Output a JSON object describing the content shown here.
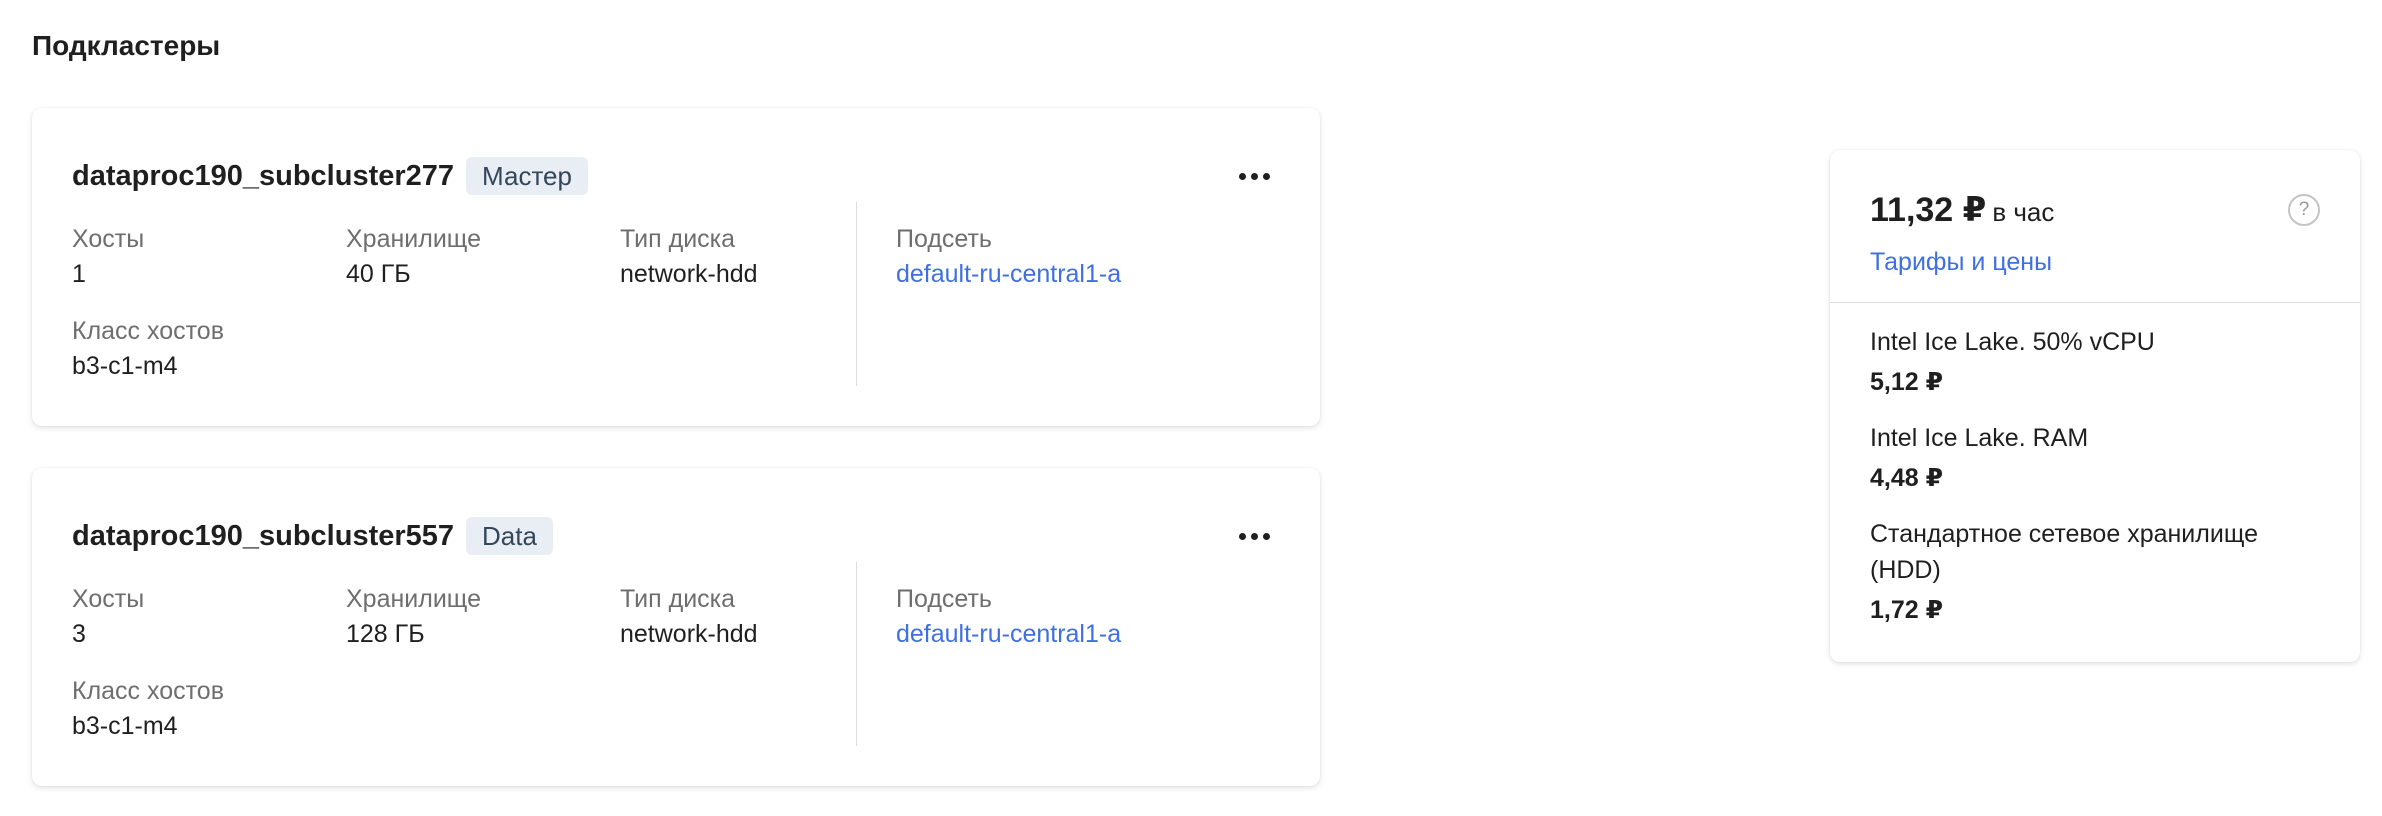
{
  "section": {
    "title": "Подкластеры"
  },
  "subclusters": [
    {
      "name": "dataproc190_subcluster277",
      "role": "Мастер",
      "hosts_label": "Хосты",
      "hosts_value": "1",
      "storage_label": "Хранилище",
      "storage_value": "40 ГБ",
      "disk_label": "Тип диска",
      "disk_value": "network-hdd",
      "subnet_label": "Подсеть",
      "subnet_value": "default-ru-central1-a",
      "class_label": "Класс хостов",
      "class_value": "b3-c1-m4"
    },
    {
      "name": "dataproc190_subcluster557",
      "role": "Data",
      "hosts_label": "Хосты",
      "hosts_value": "3",
      "storage_label": "Хранилище",
      "storage_value": "128 ГБ",
      "disk_label": "Тип диска",
      "disk_value": "network-hdd",
      "subnet_label": "Подсеть",
      "subnet_value": "default-ru-central1-a",
      "class_label": "Класс хостов",
      "class_value": "b3-c1-m4"
    }
  ],
  "pricing": {
    "total": "11,32 ₽",
    "unit": "в час",
    "help_symbol": "?",
    "tariffs_link": "Тарифы и цены",
    "items": [
      {
        "name": "Intel Ice Lake. 50% vCPU",
        "price": "5,12 ₽"
      },
      {
        "name": "Intel Ice Lake. RAM",
        "price": "4,48 ₽"
      },
      {
        "name": "Стандартное сетевое хранилище (HDD)",
        "price": "1,72 ₽"
      }
    ]
  },
  "colors": {
    "link": "#3f6fe0",
    "badge_bg": "#e9eef5",
    "badge_text": "#34465a"
  },
  "icons": {
    "more": "more-horizontal-icon",
    "help": "question-circle-icon"
  }
}
